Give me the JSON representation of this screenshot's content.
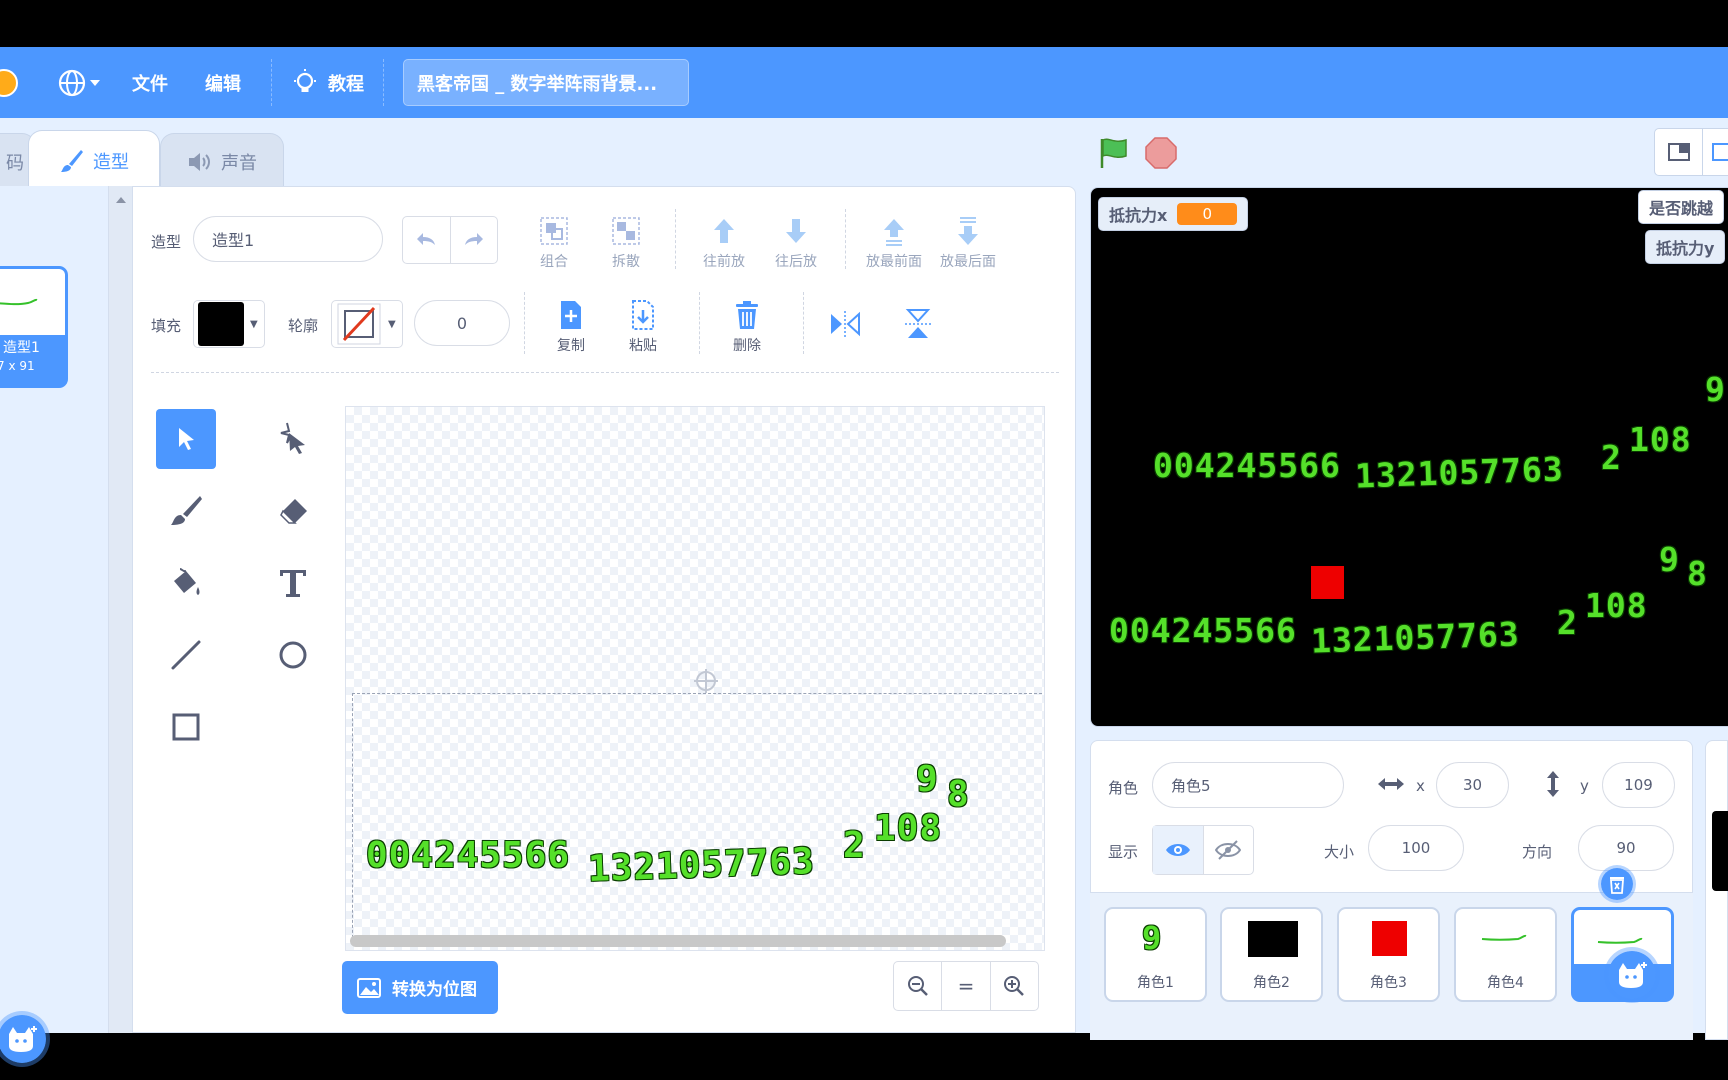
{
  "menubar": {
    "file": "文件",
    "edit": "编辑",
    "tutorial": "教程",
    "project_title": "黑客帝国 _ 数字举阵雨背景..."
  },
  "tabs": {
    "code_fragment": "码",
    "costumes": "造型",
    "sounds": "声音"
  },
  "costume_list": {
    "item_name": "造型1",
    "item_size": "7 x 91"
  },
  "editor": {
    "costume_label": "造型",
    "costume_name": "造型1",
    "group": "组合",
    "ungroup": "拆散",
    "forward": "往前放",
    "backward": "往后放",
    "front": "放最前面",
    "back": "放最后面",
    "fill_label": "填充",
    "fill_color": "#000000",
    "outline_label": "轮廓",
    "outline_width": "0",
    "copy": "复制",
    "paste": "粘贴",
    "delete": "删除",
    "convert_bitmap": "转换为位图",
    "zoom_reset": "="
  },
  "canvas": {
    "digits_main": "004245566",
    "digits_mid": "1321057763",
    "digits_tail": "2",
    "digits_108": "108",
    "digits_9": "9",
    "digits_8": "8"
  },
  "stage": {
    "var1_label": "抵抗力x",
    "var1_value": "0",
    "var2_label": "是否跳越",
    "var3_label": "抵抗力y",
    "digits_a": "004245566",
    "digits_b": "1321057763",
    "digits_c": "2",
    "digits_d": "108",
    "digits_e": "9",
    "digits_f": "8"
  },
  "sprite": {
    "sprite_label": "角色",
    "sprite_name": "角色5",
    "x_label": "x",
    "x_value": "30",
    "y_label": "y",
    "y_value": "109",
    "show_label": "显示",
    "size_label": "大小",
    "size_value": "100",
    "direction_label": "方向",
    "direction_value": "90",
    "tiles": [
      {
        "name": "角色1",
        "thumb": "9"
      },
      {
        "name": "角色2"
      },
      {
        "name": "角色3"
      },
      {
        "name": "角色4"
      }
    ]
  },
  "colors": {
    "accent": "#4c97ff",
    "digit_green": "#55e02a",
    "var_orange": "#ff8c1a",
    "red_sprite": "#ee0000"
  }
}
